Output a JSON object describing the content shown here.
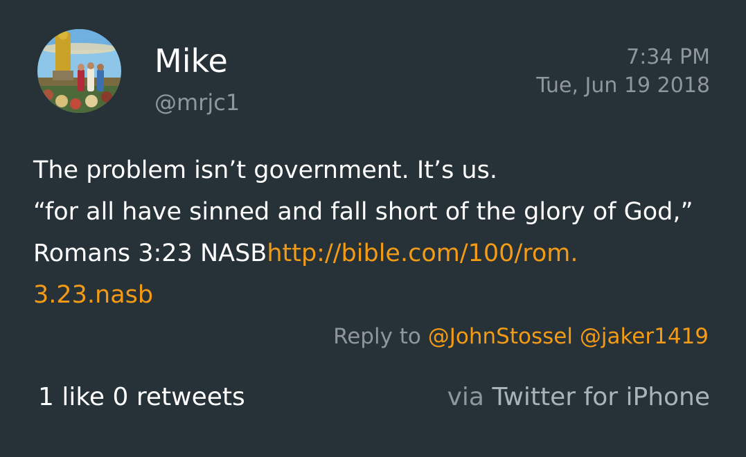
{
  "user": {
    "display_name": "Mike",
    "handle": "@mrjc1"
  },
  "meta": {
    "time": "7:34 PM",
    "date": "Tue, Jun 19 2018"
  },
  "tweet": {
    "line1": "The problem isn’t government. It’s us.",
    "line2": "“for all have sinned and fall short of the glory of God,”",
    "line3_text": "Romans 3:23 NASB",
    "link_part1": "http://bible.com/100/rom.",
    "link_part2": "3.23.nasb"
  },
  "reply": {
    "prefix": "Reply to",
    "mentions": [
      "@JohnStossel",
      "@jaker1419"
    ]
  },
  "stats": {
    "likes_count": "1",
    "likes_label": "like",
    "retweets_count": "0",
    "retweets_label": "retweets"
  },
  "source": {
    "prefix": "via",
    "client": "Twitter for iPhone"
  },
  "colors": {
    "background": "#263238",
    "link": "#f49b16",
    "secondary_text": "#8f979b",
    "primary_text": "#ffffff"
  },
  "icons": {
    "avatar": "profile-photo"
  }
}
